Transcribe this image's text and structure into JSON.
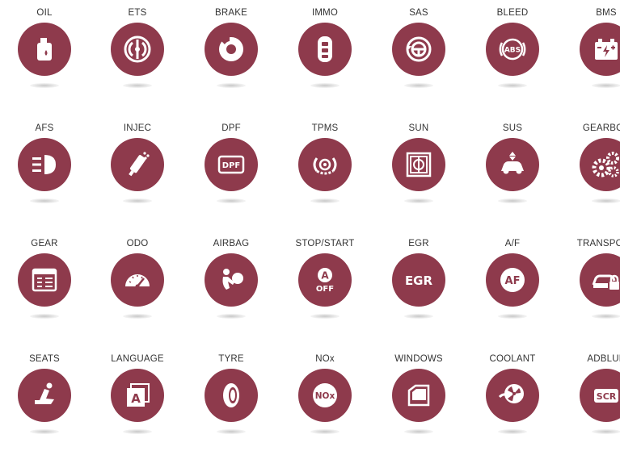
{
  "colors": {
    "accent": "#8e3a4c",
    "icon": "#ffffff",
    "label": "#333333"
  },
  "rows": [
    [
      {
        "label": "OIL",
        "icon": "oil-can-icon"
      },
      {
        "label": "ETS",
        "icon": "throttle-icon"
      },
      {
        "label": "BRAKE",
        "icon": "brake-disc-icon"
      },
      {
        "label": "IMMO",
        "icon": "key-fob-icon"
      },
      {
        "label": "SAS",
        "icon": "steering-wheel-icon"
      },
      {
        "label": "BLEED",
        "icon": "abs-icon",
        "text": "ABS"
      },
      {
        "label": "BMS",
        "icon": "battery-icon"
      }
    ],
    [
      {
        "label": "AFS",
        "icon": "headlight-icon"
      },
      {
        "label": "INJEC",
        "icon": "injector-icon"
      },
      {
        "label": "DPF",
        "icon": "dpf-icon",
        "text": "DPF"
      },
      {
        "label": "TPMS",
        "icon": "tire-pressure-icon"
      },
      {
        "label": "SUN",
        "icon": "sunroof-icon"
      },
      {
        "label": "SUS",
        "icon": "suspension-icon"
      },
      {
        "label": "GEARBOX",
        "icon": "gears-icon"
      }
    ],
    [
      {
        "label": "GEAR",
        "icon": "gear-learn-icon"
      },
      {
        "label": "ODO",
        "icon": "odometer-icon"
      },
      {
        "label": "AIRBAG",
        "icon": "airbag-icon"
      },
      {
        "label": "STOP/START",
        "icon": "stop-start-icon",
        "text": "A",
        "text2": "OFF"
      },
      {
        "label": "EGR",
        "icon": "egr-icon",
        "text": "EGR"
      },
      {
        "label": "A/F",
        "icon": "af-icon",
        "text": "AF"
      },
      {
        "label": "TRANSPORT",
        "icon": "car-lock-icon"
      }
    ],
    [
      {
        "label": "SEATS",
        "icon": "seat-icon"
      },
      {
        "label": "LANGUAGE",
        "icon": "language-icon",
        "text": "A"
      },
      {
        "label": "TYRE",
        "icon": "tyre-icon"
      },
      {
        "label": "NOx",
        "icon": "nox-icon",
        "text": "NOx"
      },
      {
        "label": "WINDOWS",
        "icon": "window-icon"
      },
      {
        "label": "COOLANT",
        "icon": "coolant-fan-icon"
      },
      {
        "label": "ADBLUE",
        "icon": "scr-icon",
        "text": "SCR"
      }
    ]
  ]
}
